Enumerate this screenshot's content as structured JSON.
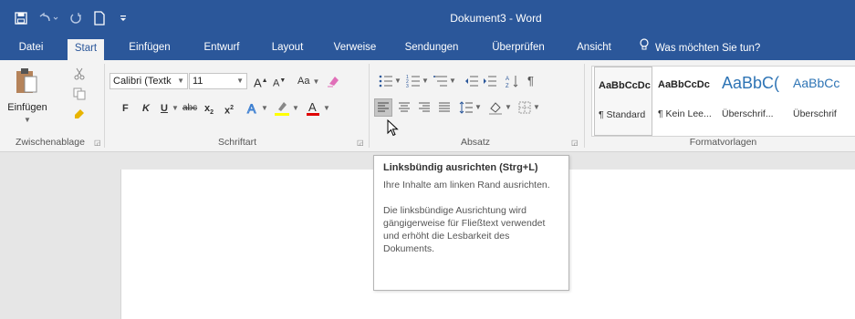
{
  "window": {
    "title": "Dokument3 - Word",
    "tell_me": "Was möchten Sie tun?"
  },
  "tabs": [
    "Datei",
    "Start",
    "Einfügen",
    "Entwurf",
    "Layout",
    "Verweise",
    "Sendungen",
    "Überprüfen",
    "Ansicht"
  ],
  "clipboard": {
    "paste_label": "Einfügen",
    "group_label": "Zwischenablage"
  },
  "font": {
    "font_name": "Calibri (Textk",
    "font_size": "11",
    "bold": "F",
    "italic": "K",
    "underline": "U",
    "strike": "abc",
    "sub": "x",
    "sup": "x",
    "case": "Aa",
    "grow": "A",
    "shrink": "A",
    "color": "A",
    "group_label": "Schriftart"
  },
  "paragraph": {
    "group_label": "Absatz",
    "pilcrow": "¶"
  },
  "styles": {
    "group_label": "Formatvorlagen",
    "items": [
      {
        "preview": "AaBbCcDc",
        "name": "¶ Standard"
      },
      {
        "preview": "AaBbCcDc",
        "name": "¶ Kein Lee..."
      },
      {
        "preview": "AaBbC(",
        "name": "Überschrif..."
      },
      {
        "preview": "AaBbCc",
        "name": "Überschrif"
      }
    ]
  },
  "tooltip": {
    "title": "Linksbündig ausrichten (Strg+L)",
    "line1": "Ihre Inhalte am linken Rand ausrichten.",
    "line2": "Die linksbündige Ausrichtung wird gängigerweise für Fließtext verwendet und erhöht die Lesbarkeit des Dokuments."
  },
  "colors": {
    "accent": "#2b579a",
    "highlight": "#ffff00",
    "font_color": "#e00000"
  }
}
